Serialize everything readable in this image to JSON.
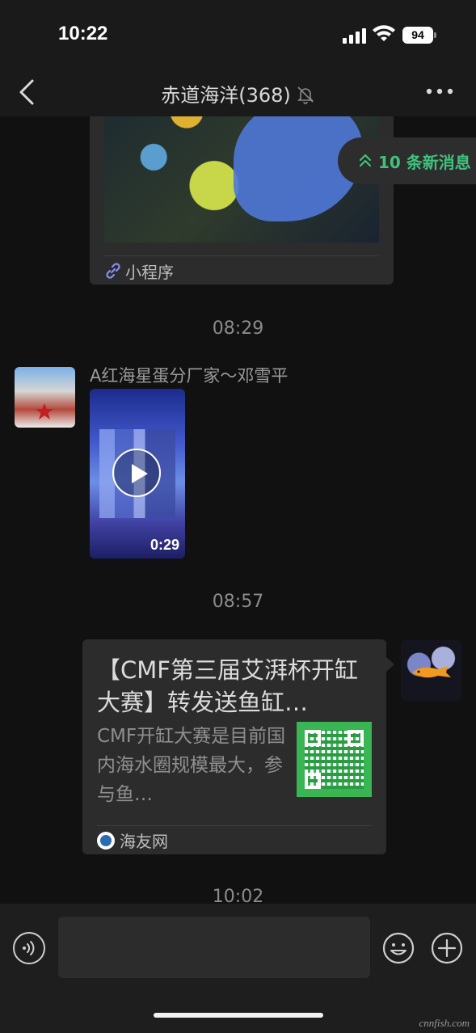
{
  "status_bar": {
    "time": "10:22",
    "battery": "94",
    "icons": [
      "cellular-signal-icon",
      "wifi-icon",
      "battery-icon"
    ]
  },
  "nav": {
    "title": "赤道海洋(368)",
    "icons": [
      "back-icon",
      "mute-bell-icon",
      "more-icon"
    ]
  },
  "new_messages": {
    "label": "10 条新消息",
    "icon": "double-chevron-up-icon",
    "color": "#3fc27c"
  },
  "chat": {
    "mini_program_card": {
      "footer_label": "小程序",
      "icon": "link-icon"
    },
    "messages": [
      {
        "timestamp": "08:29",
        "sender": "A红海星蛋分厂家～邓雪平",
        "type": "video",
        "duration": "0:29"
      },
      {
        "timestamp": "08:57",
        "type": "article",
        "title": "【CMF第三届艾湃杯开缸大赛】转发送鱼缸…",
        "description": "CMF开缸大赛是目前国内海水圈规模最大，参与鱼…",
        "source": "海友网"
      },
      {
        "timestamp": "10:02"
      }
    ]
  },
  "input_bar": {
    "input_value": "",
    "icons": [
      "voice-icon",
      "emoji-icon",
      "plus-icon"
    ]
  },
  "watermark": "cnnfish.com"
}
